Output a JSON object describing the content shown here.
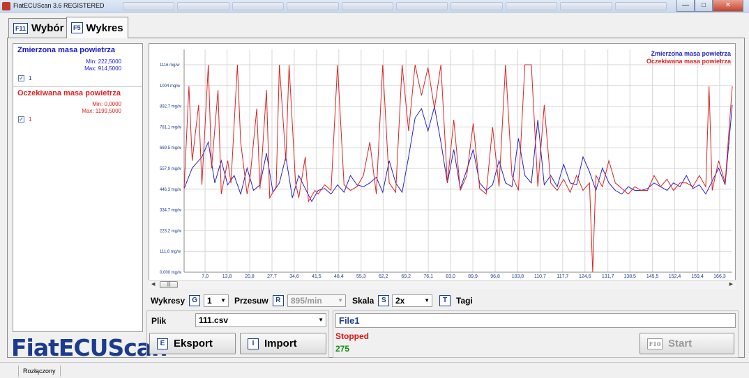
{
  "window": {
    "title": "FiatECUScan 3.6 REGISTERED"
  },
  "tabs": [
    {
      "key": "F11",
      "label": "Wybór"
    },
    {
      "key": "F5",
      "label": "Wykres"
    }
  ],
  "series_panel": [
    {
      "name": "Zmierzona masa powietrza",
      "min": "Min: 222,5000",
      "max": "Max: 914,5000",
      "checkbox_label": "1",
      "checked": true,
      "color": "#1a1acc"
    },
    {
      "name": "Oczekiwana masa powietrza",
      "min": "Min: 0,0000",
      "max": "Max: 1199,5000",
      "checkbox_label": "1",
      "checked": true,
      "color": "#dd2222"
    }
  ],
  "logo": "FiatECUScan",
  "controls": {
    "wykresy_label": "Wykresy",
    "wykresy_key": "G",
    "wykresy_value": "1",
    "przesuw_label": "Przesuw",
    "przesuw_key": "R",
    "przesuw_value": "895/min",
    "skala_label": "Skala",
    "skala_key": "S",
    "skala_value": "2x",
    "tagi_key": "T",
    "tagi_label": "Tagi"
  },
  "file": {
    "label": "Plik",
    "value": "111.csv"
  },
  "buttons": {
    "eksport_key": "E",
    "eksport": "Eksport",
    "import_key": "I",
    "import": "Import",
    "start_key": "F10",
    "start": "Start"
  },
  "status": {
    "name": "File1",
    "state": "Stopped",
    "count": "275"
  },
  "statusbar": {
    "connection": "Rozłączony"
  },
  "chart_data": {
    "type": "line",
    "y_ticks": [
      "0,000 mg/w",
      "111,6 mg/w",
      "223,2 mg/w",
      "334,7 mg/w",
      "446,3 mg/w",
      "557,9 mg/w",
      "669,5 mg/w",
      "781,1 mg/w",
      "892,7 mg/w",
      "1004 mg/w",
      "1116 mg/w"
    ],
    "x_ticks": [
      "7,0",
      "13,8",
      "20,8",
      "27,7",
      "34,6",
      "41,5",
      "48,4",
      "55,3",
      "62,2",
      "69,2",
      "76,1",
      "83,0",
      "89,9",
      "96,8",
      "103,8",
      "110,7",
      "117,7",
      "124,6",
      "131,7",
      "138,5",
      "145,5",
      "152,4",
      "159,4",
      "166,3"
    ],
    "x_range": [
      0.5,
      170.2
    ],
    "ylim": [
      0,
      1116
    ],
    "grid": true,
    "legend_position": "top-right",
    "series": [
      {
        "name": "Zmierzona masa powietrza",
        "color": "#2222cc",
        "x": [
          0.5,
          3,
          6,
          8,
          10,
          12,
          14,
          16,
          18,
          20,
          22,
          24,
          26,
          28,
          30,
          32,
          34,
          36,
          38,
          40,
          42,
          44,
          46,
          48,
          50,
          52,
          54,
          56,
          58,
          60,
          62,
          64,
          66,
          68,
          70,
          72,
          74,
          76,
          78,
          80,
          82,
          84,
          86,
          88,
          90,
          92,
          94,
          96,
          98,
          100,
          102,
          104,
          106,
          108,
          110,
          112,
          114,
          116,
          118,
          120,
          122,
          124,
          126,
          128,
          130,
          132,
          134,
          136,
          138,
          140,
          142,
          144,
          146,
          148,
          150,
          152,
          154,
          156,
          158,
          160,
          162,
          164,
          166,
          168,
          170.2
        ],
        "values": [
          450,
          560,
          620,
          700,
          480,
          600,
          470,
          520,
          420,
          560,
          440,
          470,
          640,
          430,
          480,
          620,
          400,
          520,
          450,
          380,
          440,
          450,
          420,
          470,
          430,
          520,
          470,
          460,
          480,
          510,
          430,
          600,
          480,
          430,
          620,
          830,
          880,
          760,
          890,
          700,
          480,
          660,
          450,
          550,
          660,
          480,
          440,
          470,
          600,
          480,
          460,
          720,
          520,
          480,
          820,
          470,
          520,
          460,
          580,
          480,
          470,
          620,
          540,
          440,
          560,
          480,
          440,
          420,
          460,
          440,
          440,
          450,
          480,
          460,
          440,
          480,
          460,
          520,
          450,
          470,
          420,
          490,
          560,
          470,
          900
        ]
      },
      {
        "name": "Oczekiwana masa powietrza",
        "color": "#dd2222",
        "x": [
          0.5,
          2,
          3,
          5,
          6,
          8,
          9,
          11,
          12,
          14,
          15,
          17,
          18,
          20,
          21,
          23,
          24,
          26,
          27,
          29,
          30,
          32,
          33,
          35,
          36,
          38,
          39,
          41,
          42,
          44,
          46,
          48,
          50,
          52,
          54,
          56,
          58,
          60,
          62,
          64,
          66,
          68,
          70,
          72,
          74,
          76,
          78,
          80,
          82,
          84,
          86,
          88,
          90,
          92,
          94,
          96,
          98,
          100,
          102,
          104,
          106,
          108,
          110,
          112,
          114,
          116,
          118,
          120,
          122,
          124,
          126,
          127,
          128,
          130,
          132,
          134,
          136,
          138,
          140,
          142,
          144,
          146,
          148,
          150,
          152,
          154,
          156,
          158,
          160,
          162,
          163,
          164,
          166,
          168,
          170.2
        ],
        "values": [
          450,
          1000,
          600,
          900,
          470,
          1116,
          560,
          980,
          420,
          600,
          480,
          1116,
          700,
          420,
          520,
          880,
          450,
          980,
          400,
          460,
          1116,
          600,
          1116,
          480,
          400,
          620,
          380,
          440,
          420,
          470,
          440,
          1116,
          470,
          440,
          460,
          520,
          700,
          420,
          1116,
          480,
          430,
          1116,
          760,
          1116,
          950,
          1100,
          880,
          1116,
          480,
          820,
          440,
          520,
          800,
          450,
          420,
          780,
          460,
          1116,
          520,
          440,
          1116,
          1116,
          460,
          900,
          480,
          440,
          500,
          430,
          520,
          440,
          480,
          0,
          520,
          460,
          600,
          480,
          450,
          420,
          460,
          440,
          440,
          520,
          460,
          500,
          440,
          480,
          480,
          460,
          520,
          460,
          1000,
          440,
          600,
          480,
          1000
        ]
      }
    ]
  }
}
